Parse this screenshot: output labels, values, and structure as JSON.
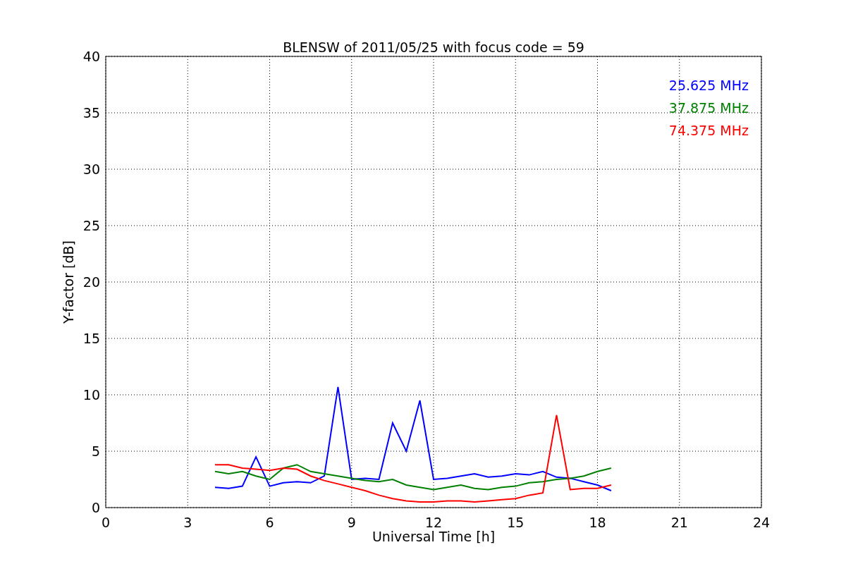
{
  "chart_data": {
    "type": "line",
    "title": "BLENSW of 2011/05/25 with focus code = 59",
    "xlabel": "Universal Time [h]",
    "ylabel": "Y-factor [dB]",
    "x": [
      4,
      4.5,
      5,
      5.5,
      6,
      6.5,
      7,
      7.5,
      8,
      8.5,
      9,
      9.5,
      10,
      10.5,
      11,
      11.5,
      12,
      12.5,
      13,
      13.5,
      14,
      14.5,
      15,
      15.5,
      16,
      16.5,
      17,
      17.5,
      18,
      18.5
    ],
    "series": [
      {
        "name": "25.625 MHz",
        "color": "#0000ff",
        "values": [
          1.8,
          1.7,
          1.9,
          4.5,
          1.9,
          2.2,
          2.3,
          2.2,
          2.8,
          10.7,
          2.5,
          2.6,
          2.5,
          7.5,
          5,
          9.5,
          2.5,
          2.6,
          2.8,
          3,
          2.7,
          2.8,
          3,
          2.9,
          3.2,
          2.7,
          2.6,
          2.3,
          2,
          1.5
        ]
      },
      {
        "name": "37.875 MHz",
        "color": "#008000",
        "values": [
          3.2,
          3,
          3.2,
          2.8,
          2.5,
          3.5,
          3.8,
          3.2,
          3,
          2.8,
          2.6,
          2.4,
          2.3,
          2.5,
          2,
          1.8,
          1.6,
          1.8,
          2,
          1.7,
          1.6,
          1.8,
          1.9,
          2.2,
          2.3,
          2.5,
          2.6,
          2.8,
          3.2,
          3.5
        ]
      },
      {
        "name": "74.375 MHz",
        "color": "#ff0000",
        "values": [
          3.8,
          3.8,
          3.5,
          3.4,
          3.3,
          3.5,
          3.4,
          2.8,
          2.4,
          2.1,
          1.8,
          1.5,
          1.1,
          0.8,
          0.6,
          0.5,
          0.5,
          0.6,
          0.6,
          0.5,
          0.6,
          0.7,
          0.8,
          1.1,
          1.3,
          8.2,
          1.6,
          1.7,
          1.7,
          2
        ]
      }
    ],
    "xlim": [
      0,
      24
    ],
    "ylim": [
      0,
      40
    ],
    "xticks": [
      0,
      3,
      6,
      9,
      12,
      15,
      18,
      21,
      24
    ],
    "yticks": [
      0,
      5,
      10,
      15,
      20,
      25,
      30,
      35,
      40
    ],
    "grid": true
  }
}
